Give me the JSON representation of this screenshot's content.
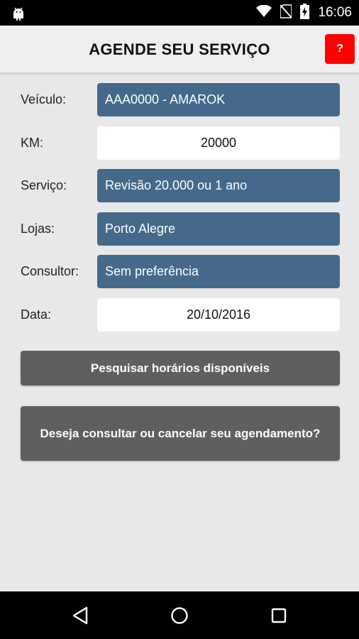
{
  "status_bar": {
    "time": "16:06",
    "icons": [
      "android-debug-icon",
      "wifi-icon",
      "no-sim-icon",
      "battery-charging-icon"
    ]
  },
  "header": {
    "title": "AGENDE SEU SERVIÇO",
    "help_label": "?"
  },
  "form": {
    "veiculo": {
      "label": "Veículo:",
      "value": "AAA0000 - AMAROK"
    },
    "km": {
      "label": "KM:",
      "value": "20000"
    },
    "servico": {
      "label": "Serviço:",
      "value": "Revisão 20.000 ou 1 ano"
    },
    "lojas": {
      "label": "Lojas:",
      "value": "Porto Alegre"
    },
    "consultor": {
      "label": "Consultor:",
      "value": "Sem preferência"
    },
    "data": {
      "label": "Data:",
      "value": "20/10/2016"
    }
  },
  "buttons": {
    "search_label": "Pesquisar horários disponíveis",
    "consult_label": "Deseja consultar ou cancelar seu agendamento?"
  },
  "nav": {
    "icons": [
      "back-icon",
      "home-icon",
      "recents-icon"
    ]
  },
  "colors": {
    "select_field": "#44698a",
    "button": "#5f5f5f",
    "help": "#ff0000",
    "background": "#e8e8e8"
  }
}
